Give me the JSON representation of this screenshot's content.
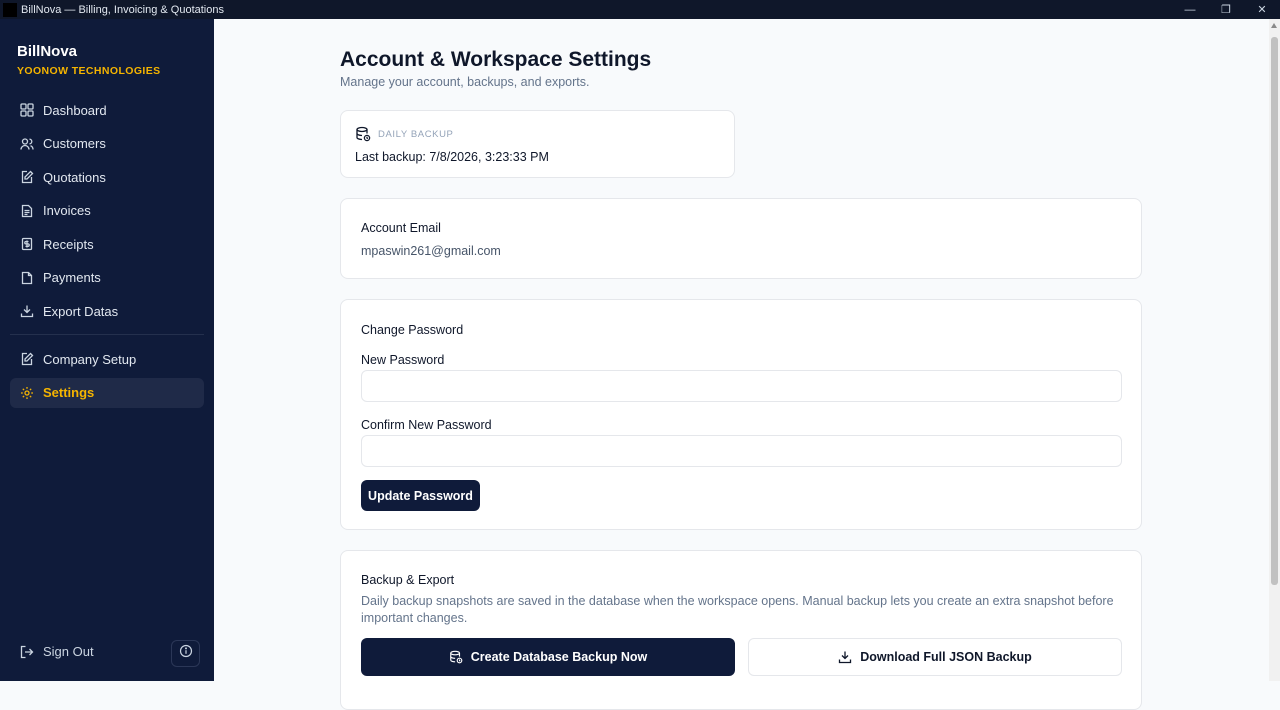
{
  "window": {
    "title": "BillNova — Billing, Invoicing & Quotations",
    "minimize": "—",
    "restore": "❐",
    "close": "✕"
  },
  "sidebar": {
    "brand_name": "BillNova",
    "brand_sub": "YOONOW TECHNOLOGIES",
    "items": [
      {
        "label": "Dashboard",
        "icon": "dashboard-icon"
      },
      {
        "label": "Customers",
        "icon": "customers-icon"
      },
      {
        "label": "Quotations",
        "icon": "quotations-icon"
      },
      {
        "label": "Invoices",
        "icon": "invoices-icon"
      },
      {
        "label": "Receipts",
        "icon": "receipts-icon"
      },
      {
        "label": "Payments",
        "icon": "payments-icon"
      },
      {
        "label": "Export Datas",
        "icon": "download-icon"
      }
    ],
    "secondary_items": [
      {
        "label": "Company Setup",
        "icon": "company-icon"
      },
      {
        "label": "Settings",
        "icon": "gear-icon",
        "active": true
      }
    ],
    "sign_out": "Sign Out"
  },
  "header": {
    "title": "Account & Workspace Settings",
    "subtitle": "Manage your account, backups, and exports."
  },
  "backup_status": {
    "label": "Daily Backup",
    "value": "Last backup: 7/8/2026, 3:23:33 PM"
  },
  "account": {
    "heading": "Account Email",
    "email": "mpaswin261@gmail.com"
  },
  "password": {
    "heading": "Change Password",
    "new_label": "New Password",
    "new_value": "",
    "confirm_label": "Confirm New Password",
    "confirm_value": "",
    "button": "Update Password"
  },
  "backup_export": {
    "heading": "Backup & Export",
    "description": "Daily backup snapshots are saved in the database when the workspace opens. Manual backup lets you create an extra snapshot before important changes.",
    "create_button": "Create Database Backup Now",
    "download_button": "Download Full JSON Backup"
  },
  "colors": {
    "sidebar_bg": "#0f1b3a",
    "accent": "#f5b400",
    "primary_button": "#0f1b3a"
  }
}
